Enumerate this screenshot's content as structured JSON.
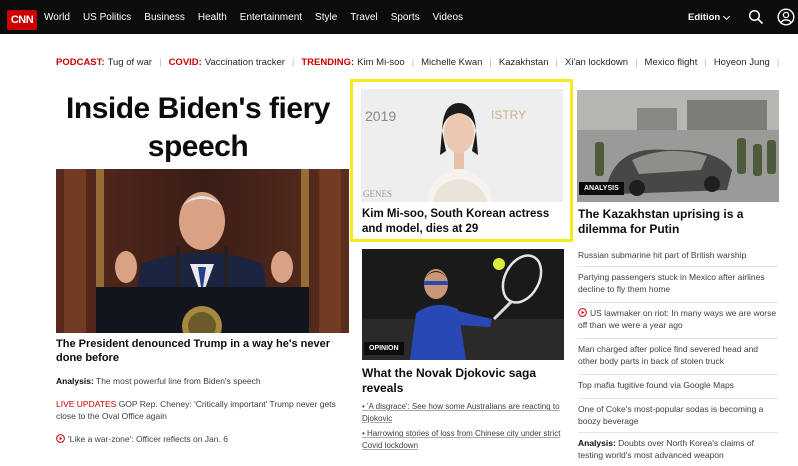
{
  "nav": {
    "logo": "CNN",
    "links": [
      "World",
      "US Politics",
      "Business",
      "Health",
      "Entertainment",
      "Style",
      "Travel",
      "Sports",
      "Videos"
    ],
    "edition": "Edition"
  },
  "trending": {
    "podcast_label": "PODCAST:",
    "podcast_value": "Tug of war",
    "covid_label": "COVID:",
    "covid_value": "Vaccination tracker",
    "trending_label": "TRENDING:",
    "topics": [
      "Kim Mi-soo",
      "Michelle Kwan",
      "Kazakhstan",
      "Xi'an lockdown",
      "Mexico flight",
      "Hoyeon Jung"
    ]
  },
  "left": {
    "headline": "Inside Biden's fiery speech",
    "caption": "The President denounced Trump in a way he's never done before",
    "analysis_label": "Analysis:",
    "analysis_text": "The most powerful line from Biden's speech",
    "live_label": "LIVE UPDATES",
    "live_text": "GOP Rep. Cheney: 'Critically important' Trump never gets close to the Oval Office again",
    "video_text": "'Like a war-zone': Officer reflects on Jan. 6"
  },
  "middle": {
    "kim_photo_text": "2019",
    "kim_photo_brand": "GENES",
    "kim_photo_brand2": "ISTRY",
    "kim_caption": "Kim Mi-soo, South Korean actress and model, dies at 29",
    "opinion_badge": "OPINION",
    "djok_caption": "What the Novak Djokovic saga reveals",
    "bullets": [
      "• 'A disgrace': See how some Australians are reacting to Djokovic",
      "• Harrowing stories of loss from Chinese city under strict Covid lockdown"
    ]
  },
  "right": {
    "analysis_badge": "ANALYSIS",
    "kaz_caption": "The Kazakhstan uprising is a dilemma for Putin",
    "items": [
      "Russian submarine hit part of British warship",
      "Partying passengers stuck in Mexico after airlines decline to fly them home",
      "US lawmaker on riot: In many ways we are worse off than we were a year ago",
      "Man charged after police find severed head and other body parts in back of stolen truck",
      "Top mafia fugitive found via Google Maps",
      "One of Coke's most-popular sodas is becoming a boozy beverage"
    ],
    "last_label": "Analysis:",
    "last_text": "Doubts over North Korea's claims of testing world's most advanced weapon"
  },
  "colors": {
    "brand_red": "#cc0000",
    "nav_bg": "#0c0c0c",
    "highlight_yellow": "#f5ea1a"
  }
}
